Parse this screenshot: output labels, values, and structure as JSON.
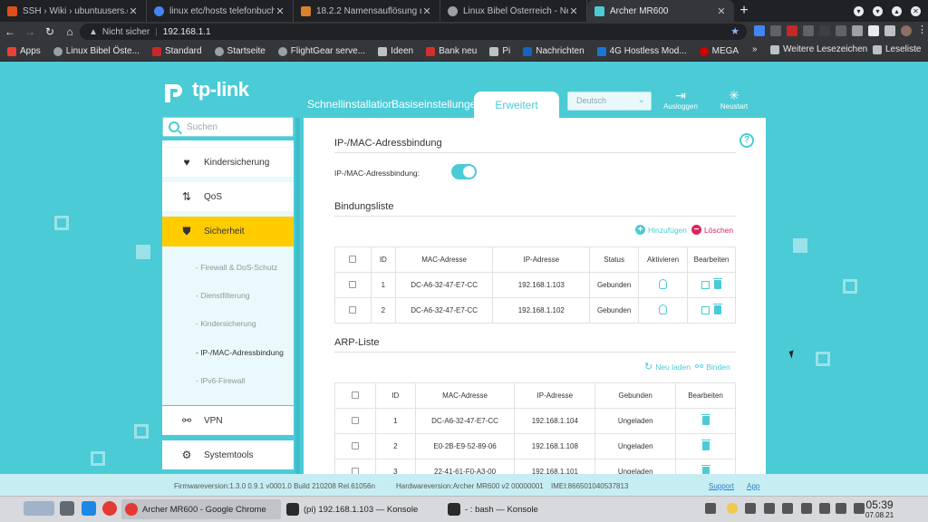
{
  "browser": {
    "tabs": [
      {
        "title": "SSH › Wiki › ubuntuusers.de",
        "icon": "ubuntuusers-favicon",
        "color": "#e04f1a"
      },
      {
        "title": "linux etc/hosts telefonbuch",
        "icon": "google-favicon",
        "color": "#4285f4"
      },
      {
        "title": "18.2.2 Namensauflösung mi",
        "icon": "page-favicon",
        "color": "#d9822b"
      },
      {
        "title": "Linux Bibel Österreich - Neu",
        "icon": "globe-favicon",
        "color": "#9aa0a6"
      },
      {
        "title": "Archer MR600",
        "icon": "tplink-favicon",
        "color": "#4acbd6",
        "active": true
      }
    ],
    "new_tab": "+",
    "nav": {
      "back": "←",
      "forward": "→",
      "reload": "↻",
      "home": "⌂"
    },
    "address": {
      "security": "Nicht sicher",
      "url": "192.168.1.1"
    },
    "bookmarks": [
      {
        "label": "Apps",
        "color": "#ea4335"
      },
      {
        "label": "Linux Bibel Öste...",
        "color": "#9aa0a6"
      },
      {
        "label": "Standard",
        "color": "#c62828"
      },
      {
        "label": "Startseite",
        "color": "#9aa0a6"
      },
      {
        "label": "FlightGear serve...",
        "color": "#9aa0a6"
      },
      {
        "label": "Ideen",
        "color": "#bdc1c6"
      },
      {
        "label": "Bank neu",
        "color": "#d32f2f"
      },
      {
        "label": "Pi",
        "color": "#bdc1c6"
      },
      {
        "label": "Nachrichten",
        "color": "#1565c0"
      },
      {
        "label": "4G Hostless Mod...",
        "color": "#1976d2"
      },
      {
        "label": "MEGA",
        "color": "#d50000"
      }
    ],
    "bookmarks_more": "»",
    "other_bookmarks": "Weitere Lesezeichen",
    "reading_list": "Leseliste"
  },
  "router": {
    "brand": "tp-link",
    "nav_tabs": {
      "quick": "Schnellinstallation",
      "basic": "Basiseinstellungen",
      "advanced": "Erweitert"
    },
    "language": "Deutsch",
    "logout": "Ausloggen",
    "reboot": "Neustart",
    "search_placeholder": "Suchen",
    "sidebar": {
      "kids": "Kindersicherung",
      "qos": "QoS",
      "security": "Sicherheit",
      "sub": [
        "- Firewall & DoS-Schutz",
        "- Dienstfilterung",
        "- Kindersicherung",
        "- IP-/MAC-Adressbindung",
        "- IPv6-Firewall"
      ],
      "vpn": "VPN",
      "system": "Systemtools"
    },
    "binding": {
      "title": "IP-/MAC-Adressbindung",
      "toggle_label": "IP-/MAC-Adressbindung:",
      "toggle_on": true,
      "help": "?"
    },
    "binding_list": {
      "title": "Bindungsliste",
      "add": "Hinzufügen",
      "delete": "Löschen",
      "headers": [
        "ID",
        "MAC-Adresse",
        "IP-Adresse",
        "Status",
        "Aktivieren",
        "Bearbeiten"
      ],
      "rows": [
        {
          "id": "1",
          "mac": "DC-A6-32-47-E7-CC",
          "ip": "192.168.1.103",
          "status": "Gebunden"
        },
        {
          "id": "2",
          "mac": "DC-A6-32-47-E7-CC",
          "ip": "192.168.1.102",
          "status": "Gebunden"
        }
      ]
    },
    "arp_list": {
      "title": "ARP-Liste",
      "reload": "Neu laden",
      "bind": "Binden",
      "headers": [
        "ID",
        "MAC-Adresse",
        "IP-Adresse",
        "Gebunden",
        "Bearbeiten"
      ],
      "rows": [
        {
          "id": "1",
          "mac": "DC-A6-32-47-E7-CC",
          "ip": "192.168.1.104",
          "bound": "Ungeladen"
        },
        {
          "id": "2",
          "mac": "E0-2B-E9-52-89-06",
          "ip": "192.168.1.108",
          "bound": "Ungeladen"
        },
        {
          "id": "3",
          "mac": "22-41-61-F0-A3-00",
          "ip": "192.168.1.101",
          "bound": "Ungeladen"
        }
      ]
    },
    "footer": {
      "firmware": "Firmwareversion:1.3.0 0.9.1 v0001.0 Build 210208 Rel.61056n",
      "hardware": "Hardwareversion:Archer MR600 v2 00000001",
      "imei": "IMEI:866501040537813",
      "support": "Support",
      "app": "App"
    }
  },
  "taskbar": {
    "tasks": [
      "Archer MR600 - Google Chrome",
      "(pi) 192.168.1.103 — Konsole",
      "- : bash — Konsole"
    ],
    "time": "05:39",
    "date": "07.08.21"
  }
}
